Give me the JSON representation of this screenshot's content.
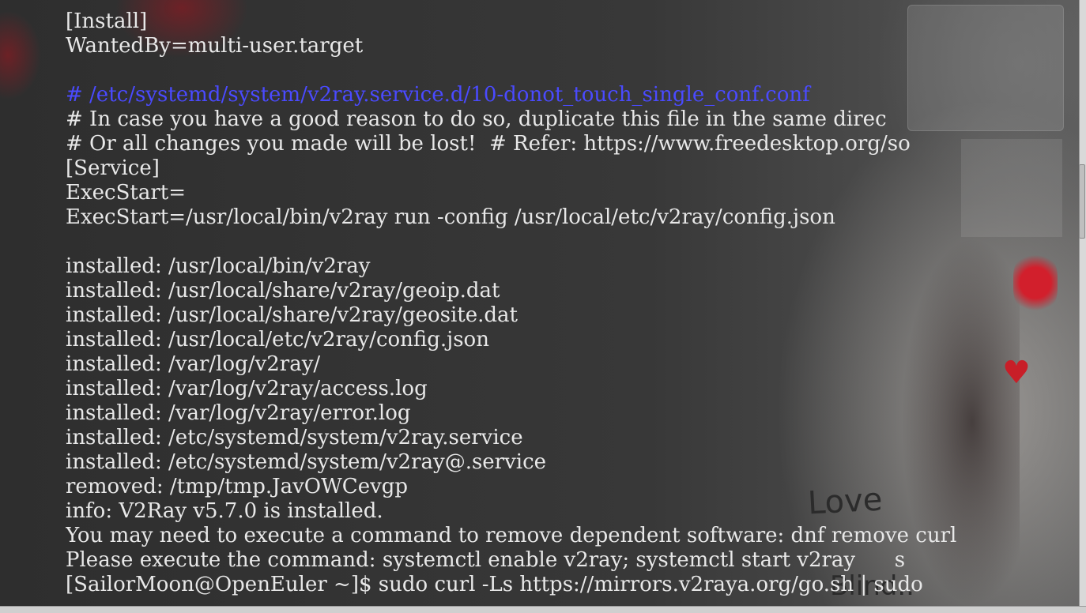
{
  "terminal": {
    "lines": [
      {
        "text": "[Install]",
        "kind": "normal"
      },
      {
        "text": "WantedBy=multi-user.target",
        "kind": "normal"
      },
      {
        "text": "",
        "kind": "blank"
      },
      {
        "text": "# /etc/systemd/system/v2ray.service.d/10-donot_touch_single_conf.conf",
        "kind": "comment-path"
      },
      {
        "text": "# In case you have a good reason to do so, duplicate this file in the same direc",
        "kind": "normal"
      },
      {
        "text": "# Or all changes you made will be lost!  # Refer: https://www.freedesktop.org/so",
        "kind": "normal"
      },
      {
        "text": "[Service]",
        "kind": "normal"
      },
      {
        "text": "ExecStart=",
        "kind": "normal"
      },
      {
        "text": "ExecStart=/usr/local/bin/v2ray run -config /usr/local/etc/v2ray/config.json",
        "kind": "normal"
      },
      {
        "text": "",
        "kind": "blank"
      },
      {
        "text": "installed: /usr/local/bin/v2ray",
        "kind": "normal"
      },
      {
        "text": "installed: /usr/local/share/v2ray/geoip.dat",
        "kind": "normal"
      },
      {
        "text": "installed: /usr/local/share/v2ray/geosite.dat",
        "kind": "normal"
      },
      {
        "text": "installed: /usr/local/etc/v2ray/config.json",
        "kind": "normal"
      },
      {
        "text": "installed: /var/log/v2ray/",
        "kind": "normal"
      },
      {
        "text": "installed: /var/log/v2ray/access.log",
        "kind": "normal"
      },
      {
        "text": "installed: /var/log/v2ray/error.log",
        "kind": "normal"
      },
      {
        "text": "installed: /etc/systemd/system/v2ray.service",
        "kind": "normal"
      },
      {
        "text": "installed: /etc/systemd/system/v2ray@.service",
        "kind": "normal"
      },
      {
        "text": "removed: /tmp/tmp.JavOWCevgp",
        "kind": "normal"
      },
      {
        "text": "info: V2Ray v5.7.0 is installed.",
        "kind": "normal"
      },
      {
        "text": "You may need to execute a command to remove dependent software: dnf remove curl",
        "kind": "normal"
      },
      {
        "text": "Please execute the command: systemctl enable v2ray; systemctl start v2ray      s",
        "kind": "normal"
      },
      {
        "text": "[SailorMoon@OpenEuler ~]$ sudo curl -Ls https://mirrors.v2raya.org/go.sh | sudo",
        "kind": "prompt"
      }
    ]
  },
  "wallpaper": {
    "love_text": "Love",
    "blind_text": "Blind..",
    "heart_glyph": "♥"
  },
  "colors": {
    "terminal_text": "#e8e8e8",
    "comment_path": "#4a4aff",
    "accent_red": "#c81e28"
  }
}
